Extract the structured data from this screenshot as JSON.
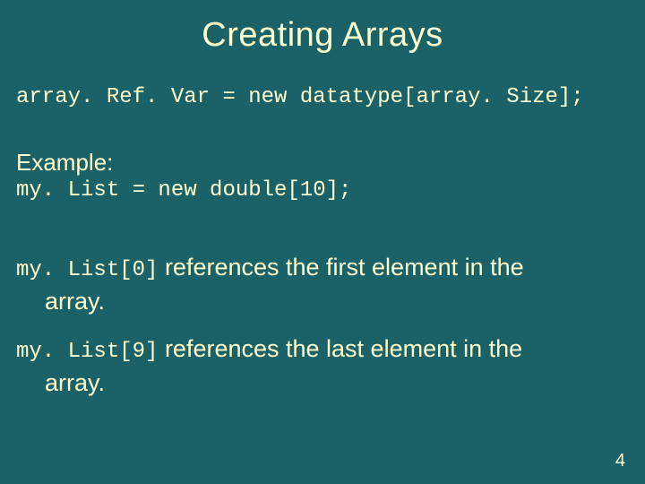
{
  "title": "Creating Arrays",
  "syntax_line": "array. Ref. Var = new datatype[array. Size];",
  "example_label": "Example:",
  "example_code": "my. List = new double[10];",
  "ref_first": {
    "code": "my. List[0]",
    "text": " references the first element in the",
    "cont": "array."
  },
  "ref_last": {
    "code": "my. List[9]",
    "text": " references the last element in the",
    "cont": "array."
  },
  "page_number": "4"
}
